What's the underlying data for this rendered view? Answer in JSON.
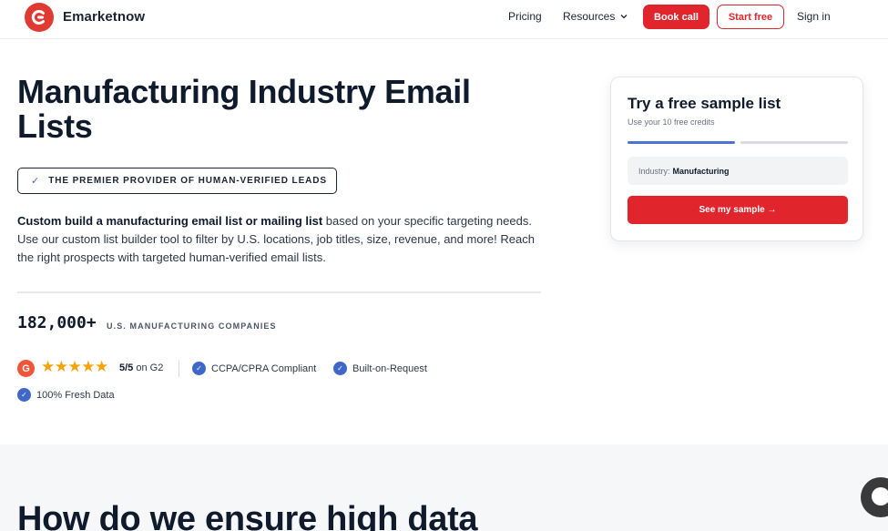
{
  "header": {
    "brand": "Emarketnow",
    "nav": {
      "pricing": "Pricing",
      "resources": "Resources",
      "book_call": "Book call",
      "start_free": "Start free",
      "sign_in": "Sign in"
    }
  },
  "hero": {
    "title": "Manufacturing Industry Email Lists",
    "badge": "THE PREMIER PROVIDER OF HUMAN-VERIFIED LEADS",
    "description_bold": "Custom build a manufacturing email list or mailing list",
    "description_rest": " based on your specific targeting needs. Use our custom list builder tool to filter by U.S. locations, job titles, size, revenue, and more! Reach the right prospects with targeted human-verified email lists.",
    "stat_number": "182,000+",
    "stat_label": "U.S. MANUFACTURING COMPANIES",
    "g2_letter": "G",
    "stars": "★★★★★",
    "rating_value": "5/5",
    "rating_suffix": " on G2",
    "checks": [
      "CCPA/CPRA Compliant",
      "Built-on-Request",
      "100% Fresh Data"
    ]
  },
  "sample_card": {
    "title": "Try a free sample list",
    "subtitle": "Use your 10 free credits",
    "industry_label": "Industry:",
    "industry_value": "Manufacturing",
    "button": "See my sample →"
  },
  "lower": {
    "title": "How do we ensure high data"
  },
  "colors": {
    "brand_red": "#e0252c",
    "accent_blue": "#3f67c9",
    "star_gold": "#f4a40a"
  },
  "icons": [
    "logo-icon",
    "chevron-down-icon",
    "check-icon",
    "g2-icon",
    "star-icon",
    "arrow-right-icon",
    "chat-icon"
  ]
}
